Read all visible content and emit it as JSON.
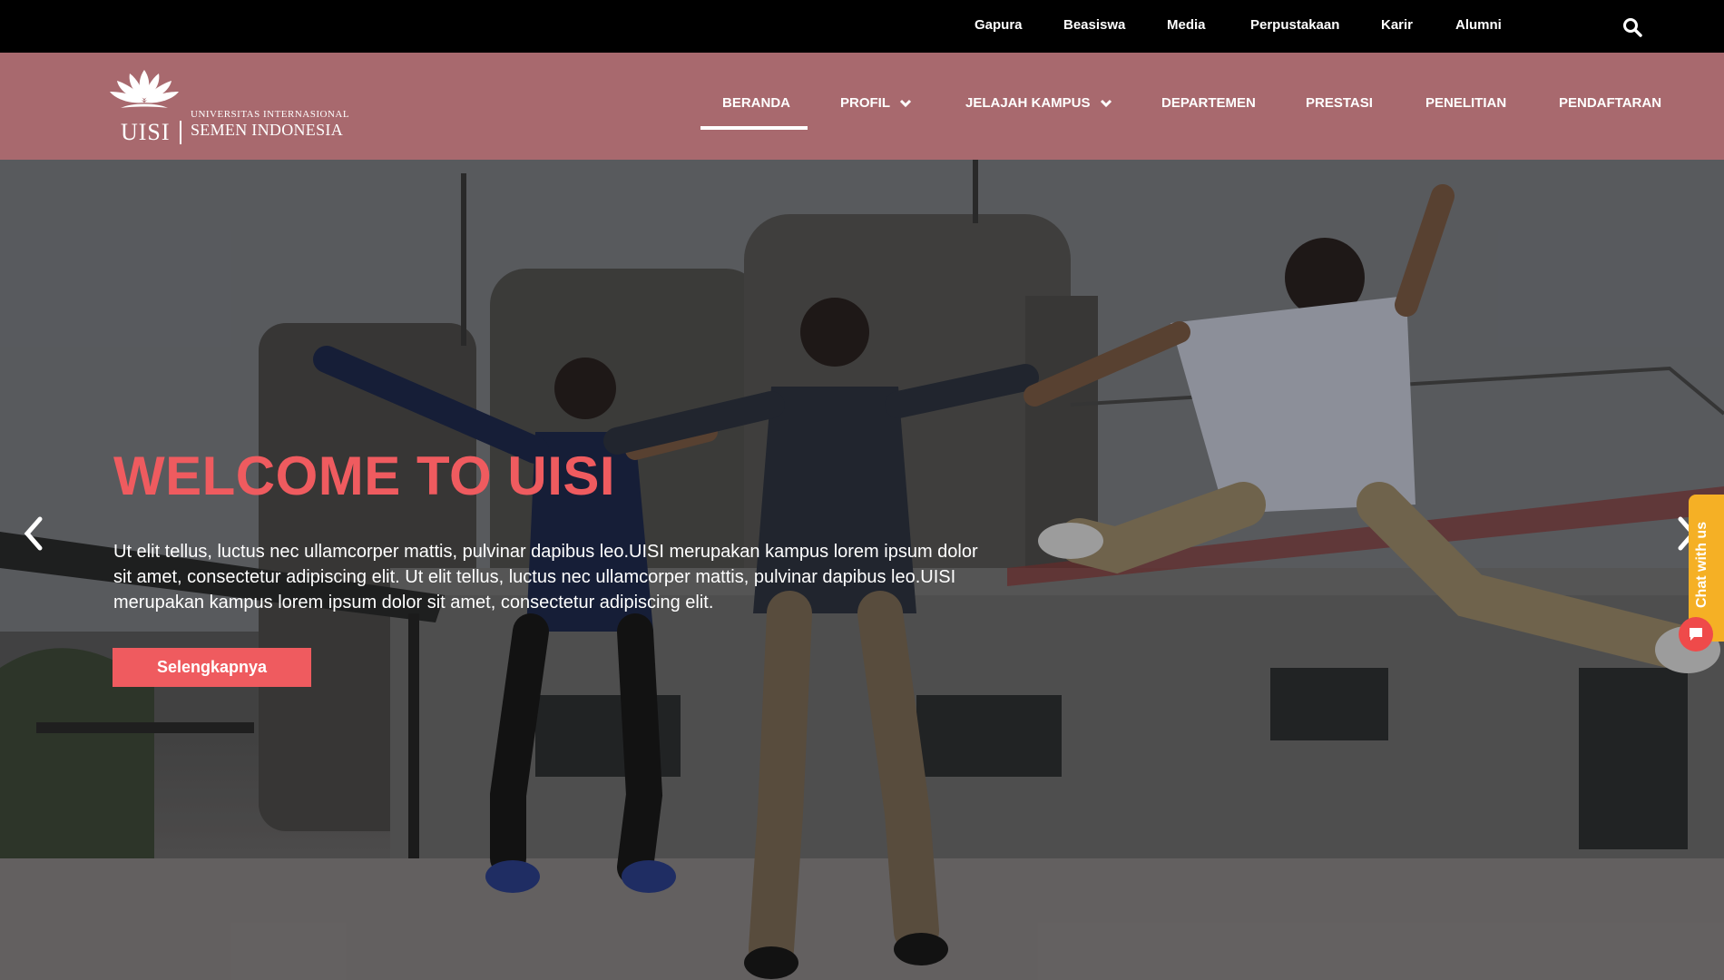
{
  "topbar": {
    "links": [
      "Gapura",
      "Beasiswa",
      "Media",
      "Perpustakaan",
      "Karir",
      "Alumni"
    ],
    "search_icon": "search-icon"
  },
  "logo": {
    "short": "UISI",
    "line1": "UNIVERSITAS INTERNASIONAL",
    "line2": "SEMEN INDONESIA"
  },
  "nav": {
    "items": [
      {
        "label": "BERANDA",
        "active": true
      },
      {
        "label": "PROFIL",
        "dropdown": true
      },
      {
        "label": "JELAJAH KAMPUS",
        "dropdown": true
      },
      {
        "label": "DEPARTEMEN"
      },
      {
        "label": "PRESTASI"
      },
      {
        "label": "PENELITIAN"
      },
      {
        "label": "PENDAFTARAN"
      }
    ]
  },
  "hero": {
    "title": "WELCOME TO UISI",
    "text": "Ut elit tellus, luctus nec ullamcorper mattis, pulvinar dapibus leo.UISI merupakan kampus lorem ipsum dolor sit amet, consectetur adipiscing elit. Ut elit tellus, luctus nec ullamcorper mattis, pulvinar dapibus leo.UISI merupakan kampus lorem ipsum dolor sit amet, consectetur adipiscing elit.",
    "button_label": "Selengkapnya"
  },
  "chat": {
    "label": "Chat with us"
  },
  "colors": {
    "topbar": "#000000",
    "navbar": "#a8696e",
    "accent": "#ef5b5f",
    "chat_tab": "#f5b025"
  }
}
